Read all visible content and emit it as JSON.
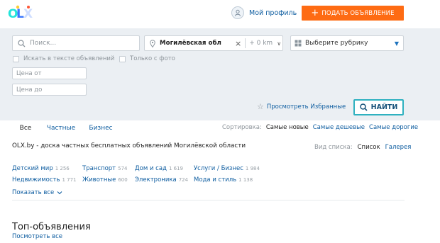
{
  "header": {
    "profile_label": "Мой профиль",
    "post_button": "ПОДАТЬ ОБЪЯВЛЕНИЕ",
    "post_button_icon": "plus-icon",
    "accent_color": "#fe6b13"
  },
  "search": {
    "query_placeholder": "Поиск...",
    "location_value": "Могилёвская обл",
    "radius_value": "+ 0 km",
    "category_value": "Выберите рубрику",
    "search_in_description_label": "Искать в тексте объявлений",
    "only_with_photo_label": "Только с фото",
    "price_from_placeholder": "Цена от",
    "price_to_placeholder": "Цена до",
    "favorites_link": "Просмотреть Избранные",
    "find_button": "НАЙТИ"
  },
  "tabs": [
    {
      "label": "Все",
      "active": true
    },
    {
      "label": "Частные",
      "active": false
    },
    {
      "label": "Бизнес",
      "active": false
    }
  ],
  "sorting": {
    "label": "Сортировка:",
    "current": "Самые новые",
    "options": [
      "Самые дешевые",
      "Самые дорогие"
    ]
  },
  "listing": {
    "title": "OLX.by - доска частных бесплатных объявлений Могилёвской области",
    "view_label": "Вид списка:",
    "view_current": "Список",
    "view_other": "Галерея"
  },
  "categories": [
    {
      "name": "Детский мир",
      "count": "1 256"
    },
    {
      "name": "Транспорт",
      "count": "574"
    },
    {
      "name": "Дом и сад",
      "count": "1 619"
    },
    {
      "name": "Услуги / Бизнес",
      "count": "1 984"
    },
    {
      "name": "Недвижимость",
      "count": "1 771"
    },
    {
      "name": "Животные",
      "count": "600"
    },
    {
      "name": "Электроника",
      "count": "724"
    },
    {
      "name": "Мода и стиль",
      "count": "1 138"
    }
  ],
  "show_all": "Показать все",
  "top_ads": {
    "title": "Топ-объявления",
    "view_all": "Посмотреть все"
  }
}
